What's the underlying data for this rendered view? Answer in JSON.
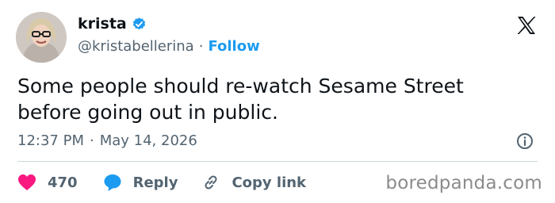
{
  "author": {
    "name": "krista",
    "handle": "@kristabellerina",
    "separator": "·",
    "follow_label": "Follow",
    "verified_color": "#1d9bf0"
  },
  "tweet": {
    "text_lines": [
      "Some people should re-watch Sesame Street",
      "before going out in public."
    ],
    "time": "12:37 PM",
    "date_separator": "·",
    "date": "May 14, 2026"
  },
  "actions": {
    "likes_count": "470",
    "reply_label": "Reply",
    "copy_link_label": "Copy link"
  },
  "icons": {
    "platform": "x-logo-icon",
    "like": "heart-icon",
    "reply": "speech-bubble-icon",
    "copy": "link-icon",
    "info": "info-icon"
  },
  "colors": {
    "like": "#f91880",
    "reply": "#1d9bf0",
    "link": "#1d9bf0",
    "text": "#0f1419",
    "muted": "#536471"
  },
  "watermark": "boredpanda.com"
}
